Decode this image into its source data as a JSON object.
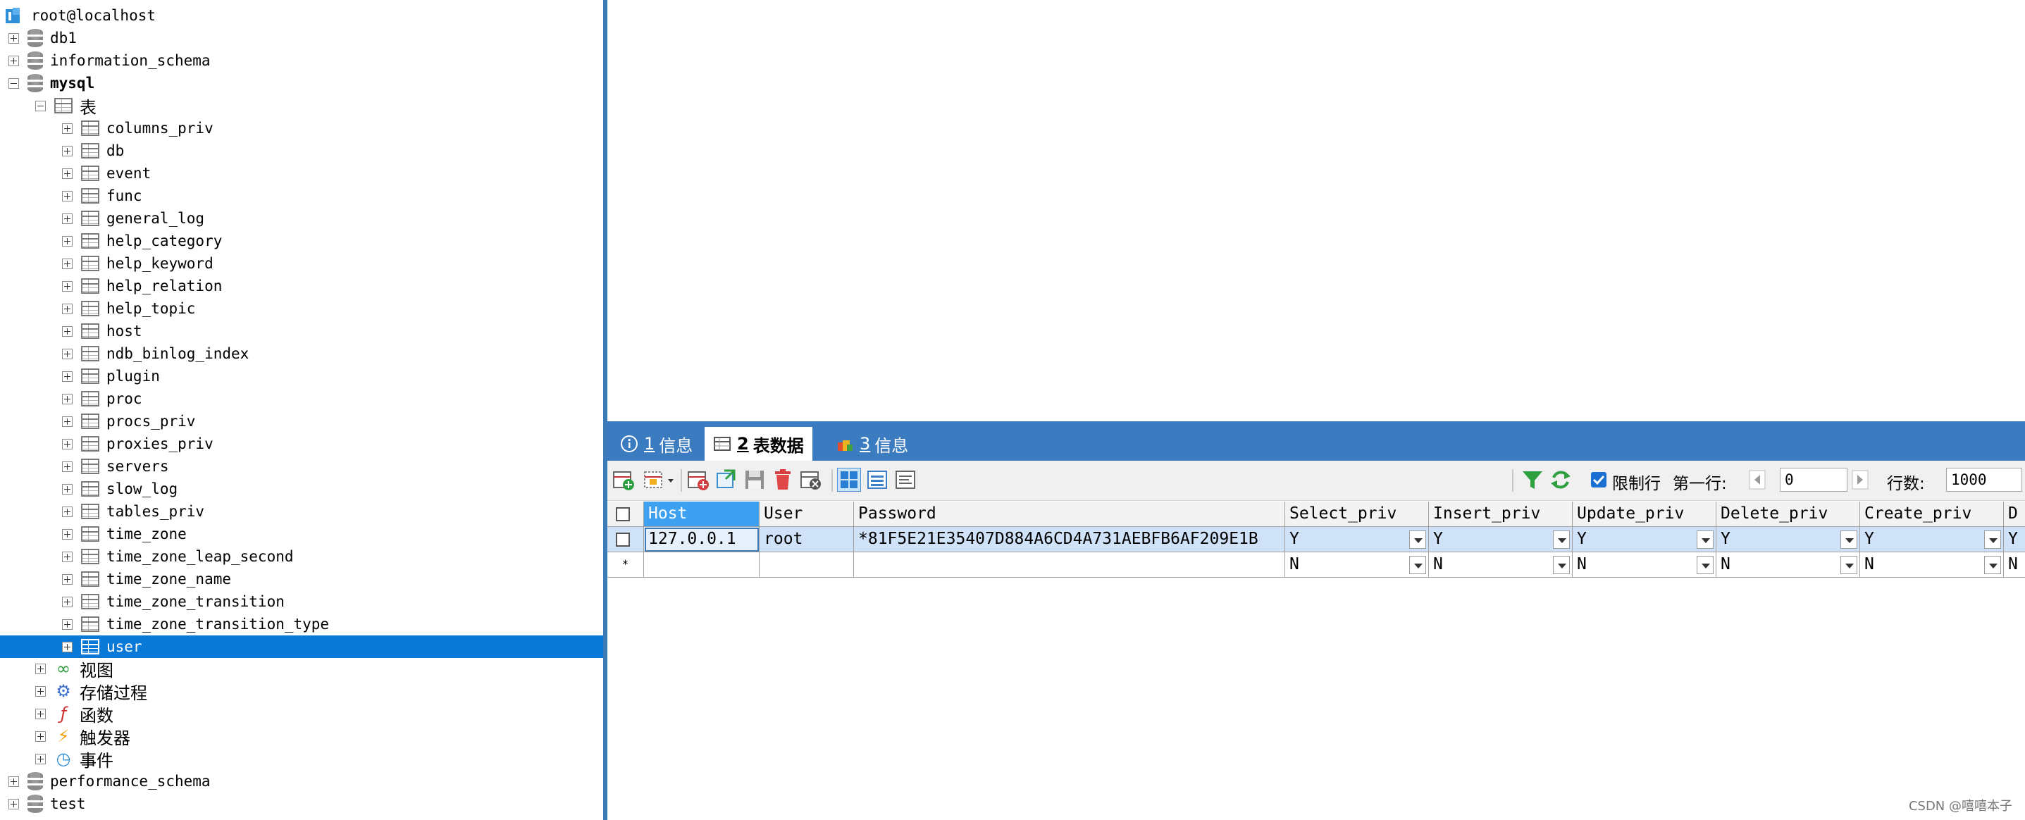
{
  "tree": {
    "connection": "root@localhost",
    "databases_top": [
      "db1",
      "information_schema"
    ],
    "open_db": "mysql",
    "tables_folder": "表",
    "tables": [
      "columns_priv",
      "db",
      "event",
      "func",
      "general_log",
      "help_category",
      "help_keyword",
      "help_relation",
      "help_topic",
      "host",
      "ndb_binlog_index",
      "plugin",
      "proc",
      "procs_priv",
      "proxies_priv",
      "servers",
      "slow_log",
      "tables_priv",
      "time_zone",
      "time_zone_leap_second",
      "time_zone_name",
      "time_zone_transition",
      "time_zone_transition_type",
      "user"
    ],
    "selected_table": "user",
    "other_folders": [
      "视图",
      "存储过程",
      "函数",
      "触发器",
      "事件"
    ],
    "databases_bottom": [
      "performance_schema",
      "test"
    ]
  },
  "tabs": [
    {
      "num": "1",
      "label": "信息"
    },
    {
      "num": "2",
      "label": "表数据"
    },
    {
      "num": "3",
      "label": "信息"
    }
  ],
  "toolbar": {
    "limit_rows_label": "限制行",
    "first_row_label": "第一行:",
    "first_row_value": "0",
    "row_count_label": "行数:",
    "row_count_value": "1000"
  },
  "grid": {
    "columns": [
      "Host",
      "User",
      "Password",
      "Select_priv",
      "Insert_priv",
      "Update_priv",
      "Delete_priv",
      "Create_priv",
      "D"
    ],
    "rows": [
      [
        "127.0.0.1",
        "root",
        "*81F5E21E35407D884A6CD4A731AEBFB6AF209E1B",
        "Y",
        "Y",
        "Y",
        "Y",
        "Y",
        "Y"
      ]
    ],
    "new_row_marker": "*",
    "new_row": [
      "",
      "",
      "",
      "N",
      "N",
      "N",
      "N",
      "N",
      "N"
    ]
  },
  "watermark": "CSDN @嘻嘻本子"
}
